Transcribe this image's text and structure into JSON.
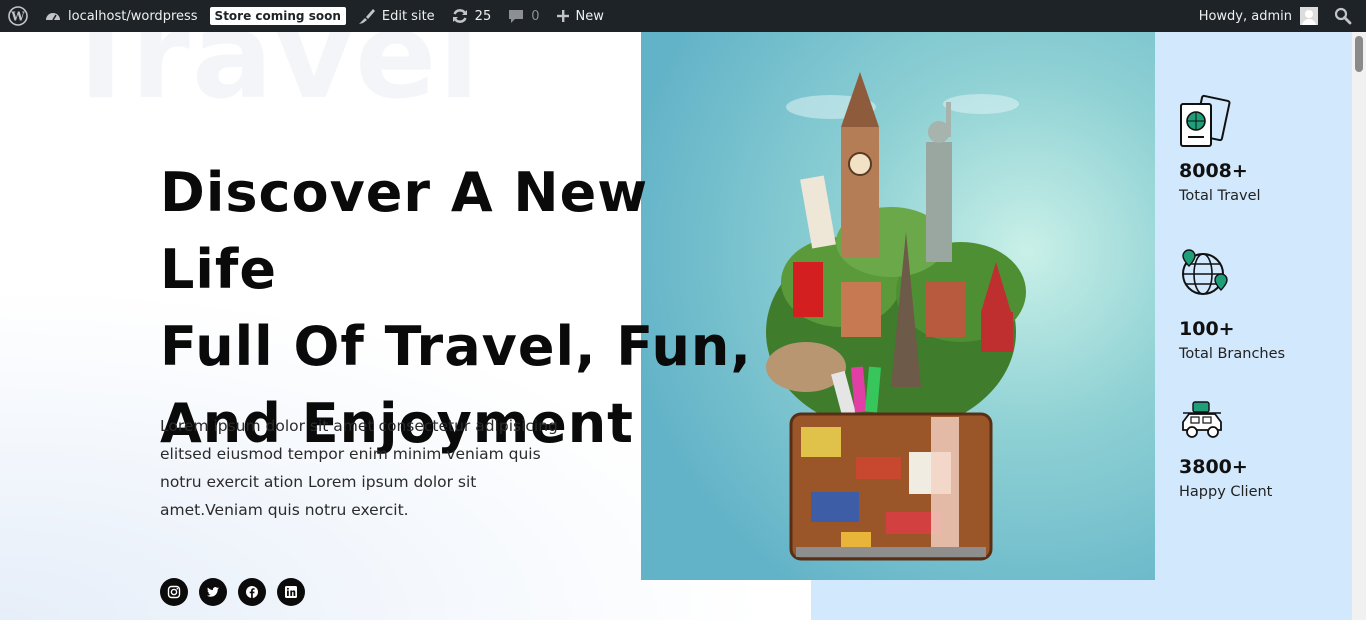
{
  "adminbar": {
    "site_name": "localhost/wordpress",
    "store_badge": "Store coming soon",
    "edit_site": "Edit site",
    "updates_count": "25",
    "comments_count": "0",
    "new_label": "New",
    "howdy": "Howdy, admin"
  },
  "hero": {
    "background_word": "Travel",
    "title_lines": [
      "Discover A New Life",
      "Full Of Travel, Fun,",
      "And Enjoyment"
    ],
    "description": "Lorem ipsum dolor sit amet consectetur adipisicing elitsed eiusmod tempor enim minim veniam quis notru exercit ation Lorem ipsum dolor sit amet.Veniam quis notru exercit.",
    "socials": [
      {
        "icon": "instagram-icon"
      },
      {
        "icon": "twitter-icon"
      },
      {
        "icon": "facebook-icon"
      },
      {
        "icon": "linkedin-icon"
      }
    ]
  },
  "stats": [
    {
      "icon": "passport-icon",
      "value": "8008+",
      "label": "Total Travel"
    },
    {
      "icon": "globe-pin-icon",
      "value": "100+",
      "label": "Total Branches"
    },
    {
      "icon": "car-luggage-icon",
      "value": "3800+",
      "label": "Happy Client"
    }
  ],
  "colors": {
    "adminbar": "#1d2327",
    "accent_panel": "#d2e8fc",
    "photo_sky": "#63b3c8",
    "text_dark": "#0a0a0a",
    "icon_green": "#1f9e7a"
  }
}
